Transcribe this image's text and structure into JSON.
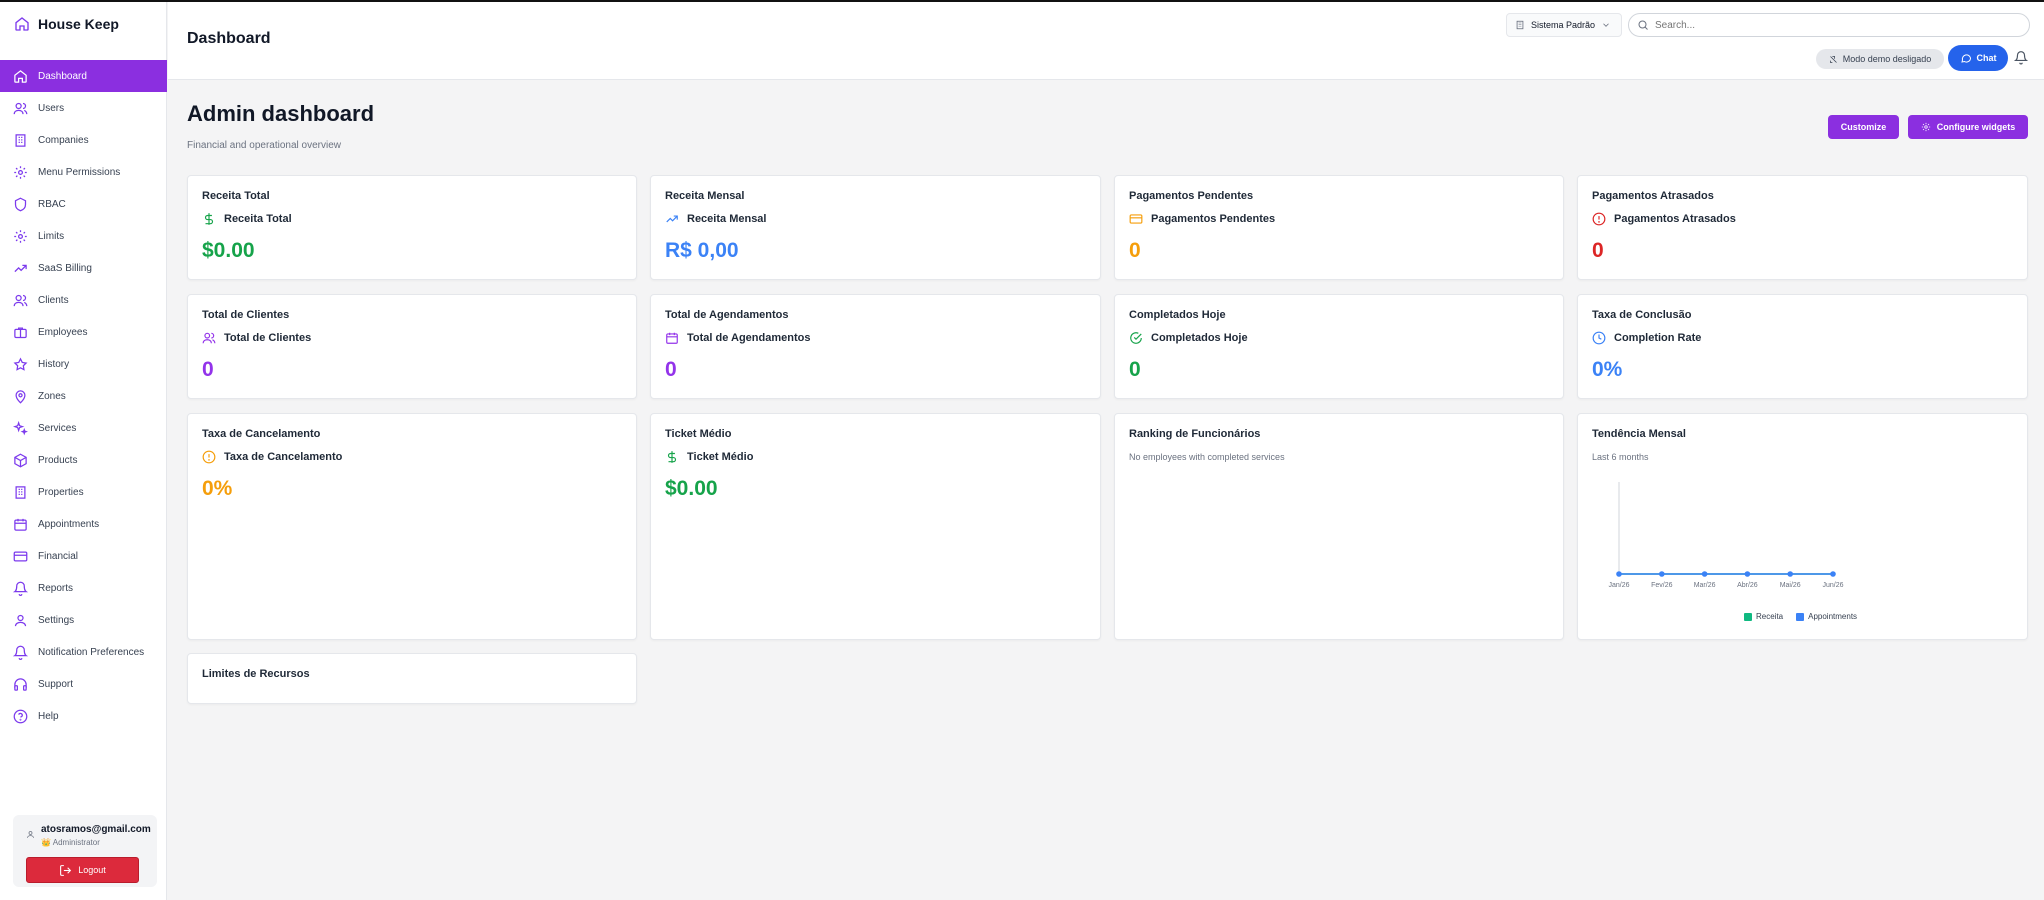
{
  "app": {
    "name": "House Keep"
  },
  "sidebar": {
    "items": [
      {
        "label": "Dashboard",
        "icon": "home-icon",
        "active": true
      },
      {
        "label": "Users",
        "icon": "users-icon"
      },
      {
        "label": "Companies",
        "icon": "building-icon"
      },
      {
        "label": "Menu Permissions",
        "icon": "gear-icon"
      },
      {
        "label": "RBAC",
        "icon": "shield-icon"
      },
      {
        "label": "Limits",
        "icon": "gear-icon"
      },
      {
        "label": "SaaS Billing",
        "icon": "trend-up-icon"
      },
      {
        "label": "Clients",
        "icon": "users-icon"
      },
      {
        "label": "Employees",
        "icon": "briefcase-icon"
      },
      {
        "label": "History",
        "icon": "star-icon"
      },
      {
        "label": "Zones",
        "icon": "map-pin-icon"
      },
      {
        "label": "Services",
        "icon": "sparkles-icon"
      },
      {
        "label": "Products",
        "icon": "package-icon"
      },
      {
        "label": "Properties",
        "icon": "building-icon"
      },
      {
        "label": "Appointments",
        "icon": "calendar-icon"
      },
      {
        "label": "Financial",
        "icon": "credit-card-icon"
      },
      {
        "label": "Reports",
        "icon": "bell-icon"
      },
      {
        "label": "Settings",
        "icon": "user-icon"
      },
      {
        "label": "Notification Preferences",
        "icon": "bell-icon"
      },
      {
        "label": "Support",
        "icon": "headphones-icon"
      },
      {
        "label": "Help",
        "icon": "help-circle-icon"
      }
    ]
  },
  "user": {
    "email": "atosramos@gmail.com",
    "role": "👑 Administrator",
    "logout_label": "Logout"
  },
  "header": {
    "title": "Dashboard",
    "system_select": "Sistema Padrão",
    "search_placeholder": "Search...",
    "demo_mode": "Modo demo desligado",
    "chat_label": "Chat"
  },
  "main": {
    "title": "Admin dashboard",
    "subtitle": "Financial and operational overview",
    "customize_label": "Customize",
    "configure_label": "Configure widgets"
  },
  "cards": {
    "receita_total": {
      "title": "Receita Total",
      "label": "Receita Total",
      "value": "$0.00"
    },
    "receita_mensal": {
      "title": "Receita Mensal",
      "label": "Receita Mensal",
      "value": "R$ 0,00"
    },
    "pag_pendentes": {
      "title": "Pagamentos Pendentes",
      "label": "Pagamentos Pendentes",
      "value": "0"
    },
    "pag_atrasados": {
      "title": "Pagamentos Atrasados",
      "label": "Pagamentos Atrasados",
      "value": "0"
    },
    "total_clientes": {
      "title": "Total de Clientes",
      "label": "Total de Clientes",
      "value": "0"
    },
    "total_agend": {
      "title": "Total de Agendamentos",
      "label": "Total de Agendamentos",
      "value": "0"
    },
    "completados": {
      "title": "Completados Hoje",
      "label": "Completados Hoje",
      "value": "0"
    },
    "taxa_conclusao": {
      "title": "Taxa de Conclusão",
      "label": "Completion Rate",
      "value": "0%"
    },
    "taxa_cancel": {
      "title": "Taxa de Cancelamento",
      "label": "Taxa de Cancelamento",
      "value": "0%"
    },
    "ticket": {
      "title": "Ticket Médio",
      "label": "Ticket Médio",
      "value": "$0.00"
    },
    "ranking": {
      "title": "Ranking de Funcionários",
      "empty": "No employees with completed services"
    },
    "tendencia": {
      "title": "Tendência Mensal",
      "subtitle": "Last 6 months"
    },
    "limites": {
      "title": "Limites de Recursos"
    }
  },
  "colors": {
    "accent": "#8b2fe0",
    "green": "#16a34a",
    "blue": "#3b82f6",
    "amber": "#f59e0b",
    "red": "#dc2626"
  },
  "chart_data": {
    "type": "line",
    "title": "Tendência Mensal",
    "subtitle": "Last 6 months",
    "categories": [
      "Jan/26",
      "Fev/26",
      "Mar/26",
      "Abr/26",
      "Mai/26",
      "Jun/26"
    ],
    "series": [
      {
        "name": "Receita",
        "values": [
          0,
          0,
          0,
          0,
          0,
          0
        ],
        "color": "#10b981"
      },
      {
        "name": "Appointments",
        "values": [
          0,
          0,
          0,
          0,
          0,
          0
        ],
        "color": "#3b82f6"
      }
    ],
    "legend": "bottom",
    "grid": false
  }
}
